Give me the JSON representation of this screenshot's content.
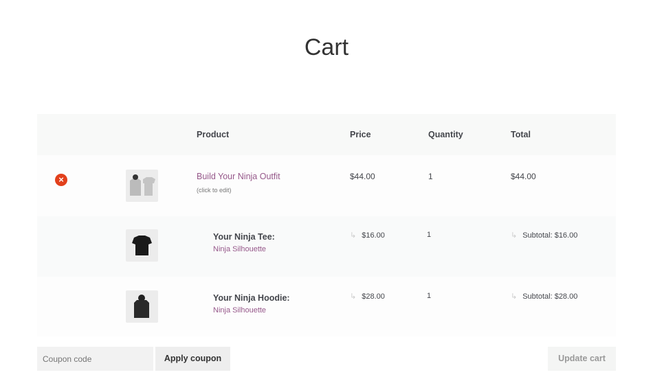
{
  "title": "Cart",
  "headers": {
    "product": "Product",
    "price": "Price",
    "quantity": "Quantity",
    "total": "Total"
  },
  "items": [
    {
      "name": "Build Your Ninja Outfit",
      "note": "(click to edit)",
      "price": "$44.00",
      "quantity": "1",
      "total": "$44.00"
    },
    {
      "label": "Your Ninja Tee:",
      "variant": "Ninja Silhouette",
      "price": "$16.00",
      "quantity": "1",
      "total": "Subtotal: $16.00"
    },
    {
      "label": "Your Ninja Hoodie:",
      "variant": "Ninja Silhouette",
      "price": "$28.00",
      "quantity": "1",
      "total": "Subtotal: $28.00"
    }
  ],
  "coupon": {
    "placeholder": "Coupon code",
    "apply_label": "Apply coupon"
  },
  "update_label": "Update cart",
  "colors": {
    "link": "#96588a",
    "remove": "#e2401c"
  }
}
